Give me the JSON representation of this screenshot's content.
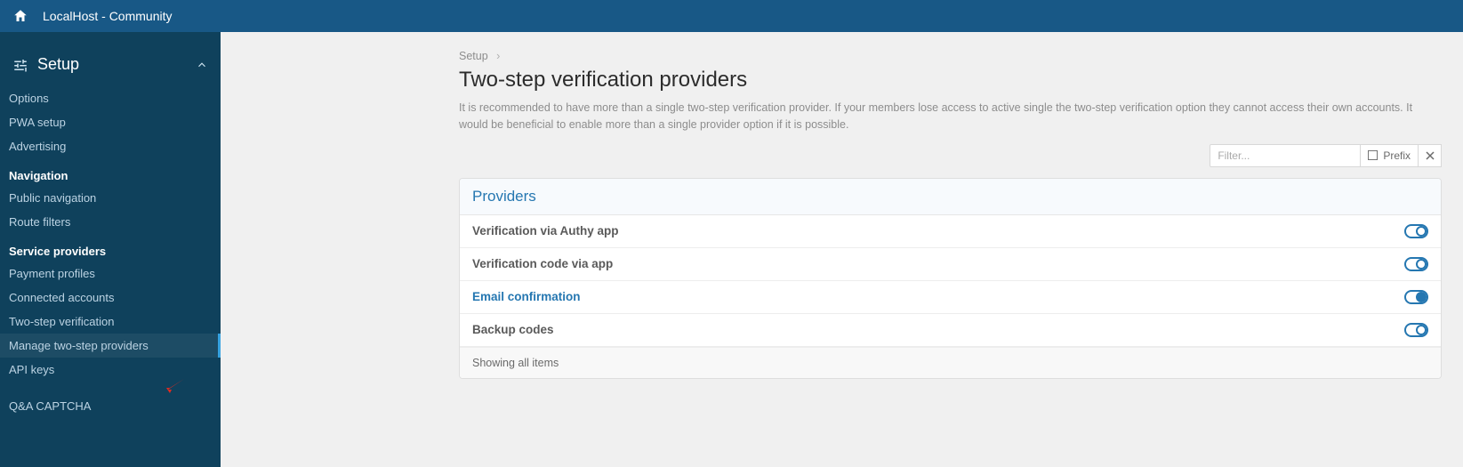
{
  "topbar": {
    "title": "LocalHost - Community"
  },
  "sidebar": {
    "section": "Setup",
    "groups": [
      {
        "items": [
          "Options",
          "PWA setup",
          "Advertising"
        ]
      },
      {
        "label": "Navigation",
        "items": [
          "Public navigation",
          "Route filters"
        ]
      },
      {
        "label": "Service providers",
        "items": [
          "Payment profiles",
          "Connected accounts",
          "Two-step verification",
          "Manage two-step providers",
          "API keys"
        ],
        "active": "Manage two-step providers"
      },
      {
        "items": [
          "Q&A CAPTCHA"
        ]
      }
    ]
  },
  "main": {
    "breadcrumb": "Setup",
    "title": "Two-step verification providers",
    "description": "It is recommended to have more than a single two-step verification provider. If your members lose access to active single the two-step verification option they cannot access their own accounts. It would be beneficial to enable more than a single provider option if it is possible.",
    "filter": {
      "placeholder": "Filter...",
      "prefix_label": "Prefix"
    },
    "panel": {
      "heading": "Providers",
      "rows": [
        {
          "label": "Verification via Authy app",
          "enabled": false
        },
        {
          "label": "Verification code via app",
          "enabled": false
        },
        {
          "label": "Email confirmation",
          "enabled": true
        },
        {
          "label": "Backup codes",
          "enabled": false
        }
      ],
      "footer": "Showing all items"
    }
  }
}
